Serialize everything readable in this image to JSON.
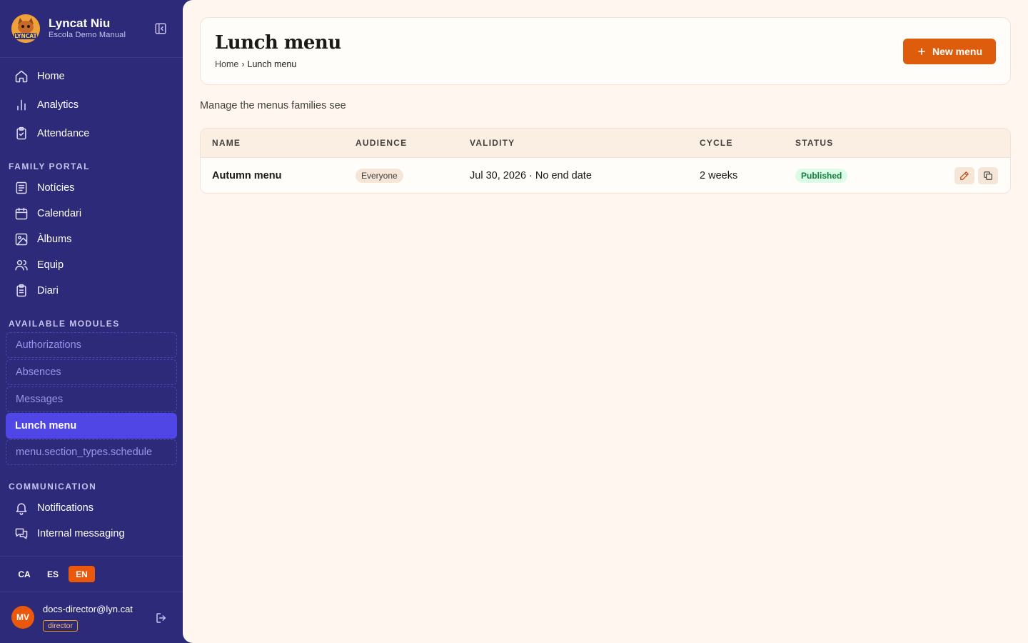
{
  "brand": {
    "name": "Lyncat Niu",
    "school": "Escola Demo Manual",
    "logo_text": "LYNCAT"
  },
  "nav": {
    "main": [
      {
        "label": "Home",
        "icon": "home-icon"
      },
      {
        "label": "Analytics",
        "icon": "bar-chart-icon"
      },
      {
        "label": "Attendance",
        "icon": "clipboard-check-icon"
      }
    ],
    "family_portal_title": "FAMILY PORTAL",
    "family_portal": [
      {
        "label": "Notícies",
        "icon": "newspaper-icon"
      },
      {
        "label": "Calendari",
        "icon": "calendar-icon"
      },
      {
        "label": "Àlbums",
        "icon": "image-icon"
      },
      {
        "label": "Equip",
        "icon": "users-icon"
      },
      {
        "label": "Diari",
        "icon": "clipboard-list-icon"
      }
    ],
    "modules_title": "AVAILABLE MODULES",
    "modules": [
      {
        "label": "Authorizations"
      },
      {
        "label": "Absences"
      },
      {
        "label": "Messages"
      },
      {
        "label": "Lunch menu"
      },
      {
        "label": "menu.section_types.schedule"
      }
    ],
    "communication_title": "COMMUNICATION",
    "communication": [
      {
        "label": "Notifications",
        "icon": "bell-icon"
      },
      {
        "label": "Internal messaging",
        "icon": "messages-icon"
      }
    ]
  },
  "languages": [
    "CA",
    "ES",
    "EN"
  ],
  "active_language": "EN",
  "user": {
    "initials": "MV",
    "email": "docs-director@lyn.cat",
    "role": "director"
  },
  "page": {
    "title": "Lunch menu",
    "breadcrumb": {
      "home": "Home",
      "separator": "›",
      "current": "Lunch menu"
    },
    "new_button": "New menu",
    "subtitle": "Manage the menus families see"
  },
  "table": {
    "headers": {
      "name": "NAME",
      "audience": "AUDIENCE",
      "validity": "VALIDITY",
      "cycle": "CYCLE",
      "status": "STATUS"
    },
    "rows": [
      {
        "name": "Autumn menu",
        "audience": "Everyone",
        "validity": "Jul 30, 2026 · No end date",
        "cycle": "2 weeks",
        "status": "Published"
      }
    ]
  },
  "colors": {
    "sidebar": "#2e2a7a",
    "accent": "#dd5d0c",
    "active_module": "#4f46e5",
    "background": "#fff7ef",
    "published": "#15803d"
  }
}
